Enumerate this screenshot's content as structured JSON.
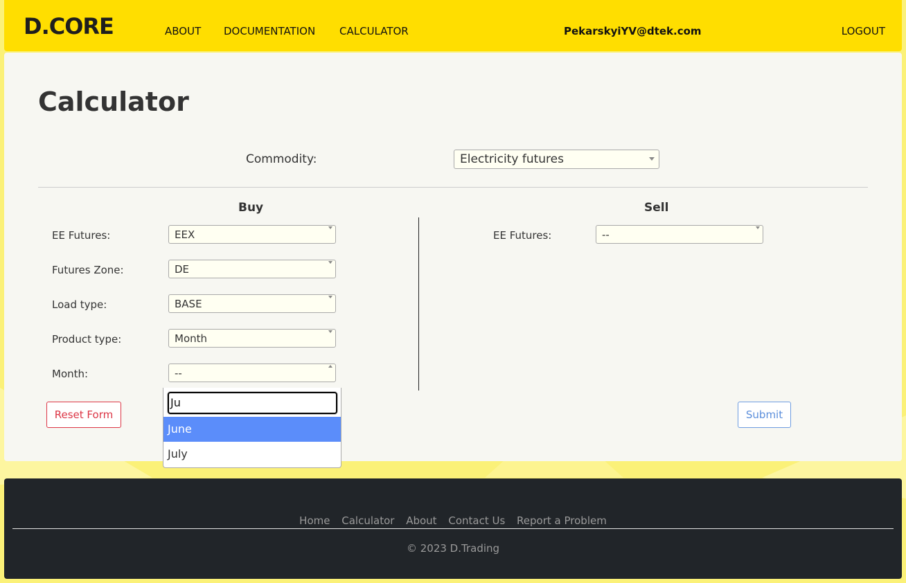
{
  "header": {
    "logo": "D.CORE",
    "nav": [
      "ABOUT",
      "DOCUMENTATION",
      "CALCULATOR"
    ],
    "user_email": "PekarskyiYV@dtek.com",
    "logout": "LOGOUT"
  },
  "main": {
    "title": "Calculator",
    "commodity": {
      "label": "Commodity:",
      "value": "Electricity futures"
    },
    "buy": {
      "title": "Buy",
      "fields": [
        {
          "label": "EE Futures:",
          "value": "EEX"
        },
        {
          "label": "Futures Zone:",
          "value": "DE"
        },
        {
          "label": "Load type:",
          "value": "BASE"
        },
        {
          "label": "Product type:",
          "value": "Month"
        },
        {
          "label": "Month:",
          "value": "--"
        }
      ]
    },
    "sell": {
      "title": "Sell",
      "fields": [
        {
          "label": "EE Futures:",
          "value": "--"
        }
      ]
    },
    "reset_label": "Reset Form",
    "submit_label": "Submit"
  },
  "dropdown": {
    "search_value": "Ju",
    "options": [
      "June",
      "July"
    ],
    "active_option": "June"
  },
  "footer": {
    "links": [
      "Home",
      "Calculator",
      "About",
      "Contact Us",
      "Report a Problem"
    ],
    "copyright": "© 2023 D.Trading"
  },
  "colors": {
    "header_bg": "#ffde00",
    "page_bg": "#fbf178",
    "footer_bg": "#212529",
    "danger": "#dc3545",
    "primary": "#5b8edb",
    "option_highlight": "#5b8dfa"
  }
}
